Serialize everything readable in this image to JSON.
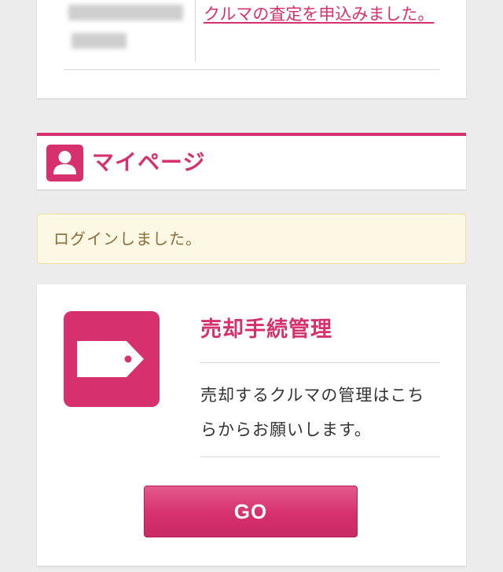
{
  "news": {
    "link_text": "クルマの査定を申込みました。"
  },
  "mypage": {
    "title": "マイページ",
    "icon": "user-icon"
  },
  "alert": {
    "text": "ログインしました。"
  },
  "sale": {
    "title": "売却手続管理",
    "description": "売却するクルマの管理はこちらからお願いします。",
    "icon": "price-tag-icon",
    "button_label": "GO"
  },
  "colors": {
    "accent": "#d6306f",
    "alert_bg": "#fcf8e3",
    "alert_text": "#8a6d3b",
    "page_bg": "#ececec"
  }
}
